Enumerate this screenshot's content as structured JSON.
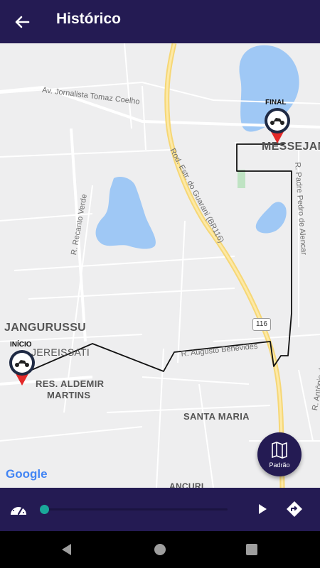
{
  "header": {
    "title": "Histórico",
    "back_icon": "arrow-left-icon"
  },
  "map": {
    "labels": {
      "av_jornalista": "Av. Jornalista Tomaz Coelho",
      "rod_estr": "Rod. Estr. do Guarani (BR116)",
      "recanto_verde": "R. Recanto Verde",
      "pedro_alencar": "R. Padre Pedro de Alencar",
      "augusto_benevides": "R. Augusto Benevides",
      "antonio_queiroz": "R. Antônio de Queiroz",
      "jangurussu": "JANGURUSSU",
      "messejana": "MESSEJANA",
      "jereissati": "JEREISSATI",
      "res_aldemir_1": "RES. ALDEMIR",
      "res_aldemir_2": "MARTINS",
      "santa_maria": "SANTA MARIA",
      "ancuri": "ANCURI",
      "highway_shield": "116"
    },
    "markers": {
      "start_label": "INÍCIO",
      "end_label": "FINAL"
    },
    "attribution": "Google",
    "fab": {
      "label": "Padrão",
      "icon": "map-icon"
    }
  },
  "playback": {
    "speed_icon": "speedometer-icon",
    "progress": 0.0,
    "play_icon": "play-icon",
    "route_icon": "route-icon"
  },
  "system_nav": {
    "back_icon": "nav-back-icon",
    "home_icon": "nav-home-icon",
    "recents_icon": "nav-recents-icon"
  },
  "colors": {
    "primary": "#241b53",
    "accent": "#1aa89a",
    "marker_red": "#e32929"
  }
}
